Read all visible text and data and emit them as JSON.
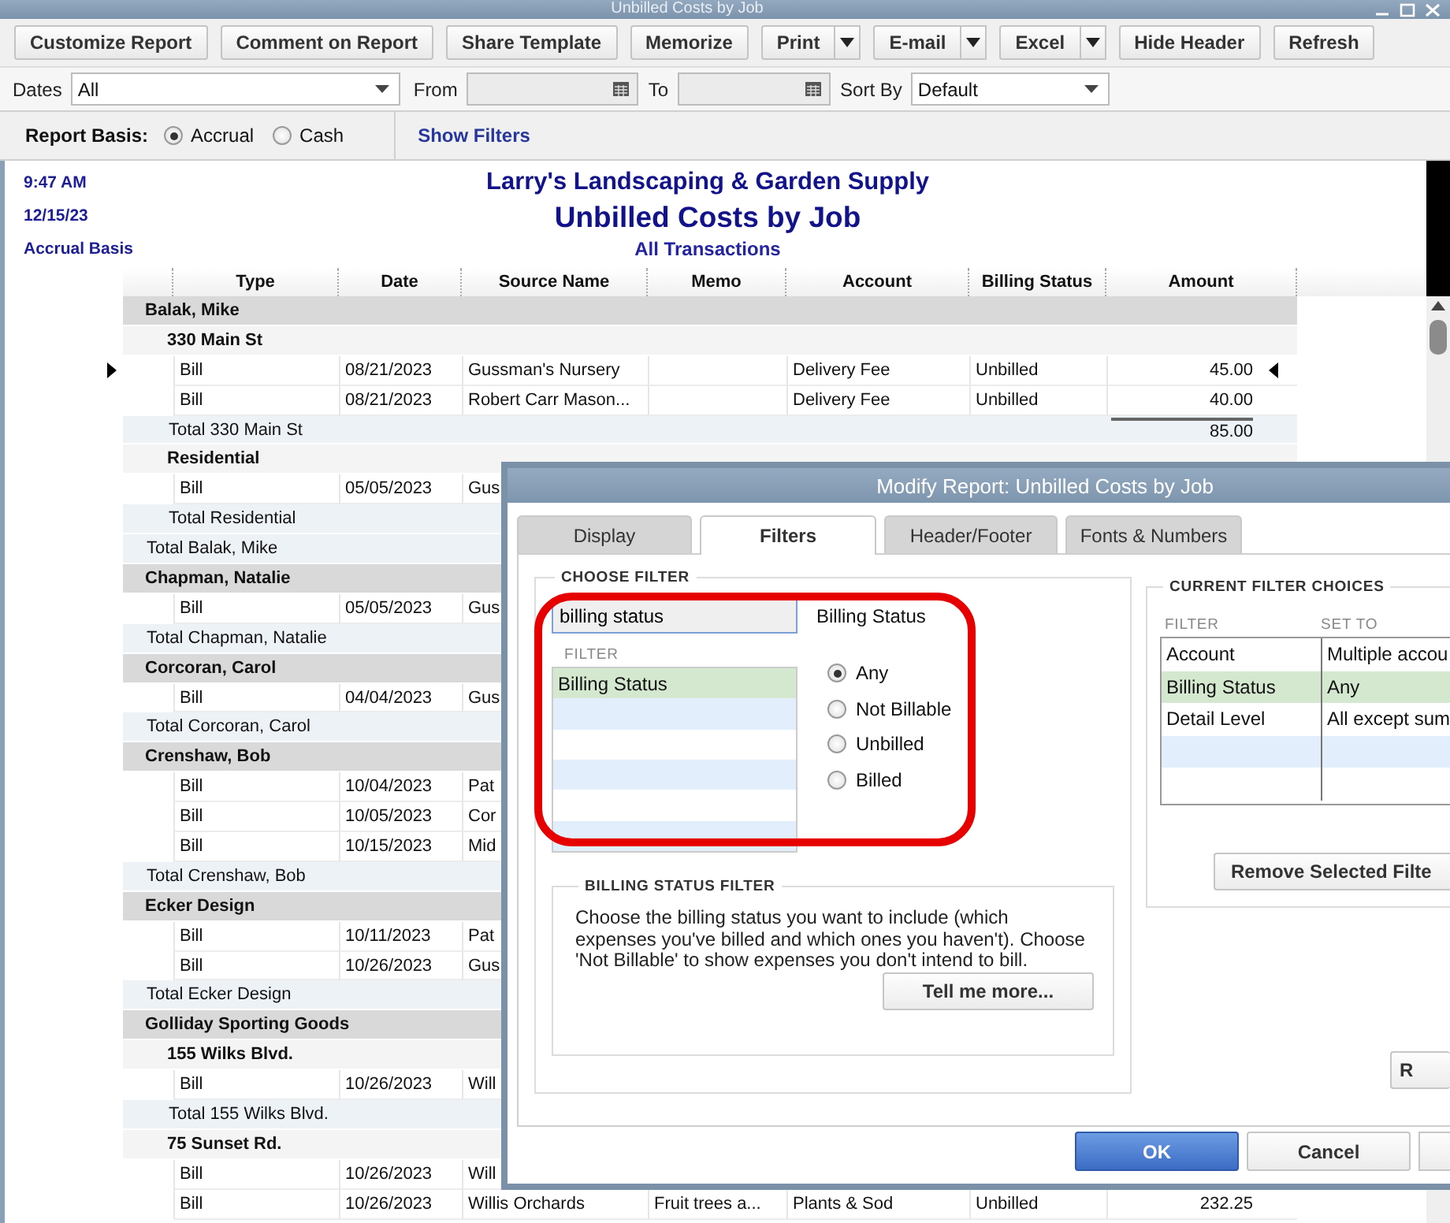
{
  "window": {
    "title": "Unbilled Costs by Job"
  },
  "toolbar": [
    {
      "label": "Customize Report",
      "kind": "button"
    },
    {
      "label": "Comment on Report",
      "kind": "button"
    },
    {
      "label": "Share Template",
      "kind": "button"
    },
    {
      "label": "Memorize",
      "kind": "button"
    },
    {
      "label": "Print",
      "kind": "split"
    },
    {
      "label": "E-mail",
      "kind": "split"
    },
    {
      "label": "Excel",
      "kind": "split"
    },
    {
      "label": "Hide Header",
      "kind": "button"
    },
    {
      "label": "Refresh",
      "kind": "button"
    }
  ],
  "filter_bar": {
    "dates_label": "Dates",
    "dates": "All",
    "from_label": "From",
    "to_label": "To",
    "sort_label": "Sort By",
    "sort": "Default"
  },
  "basis": {
    "label": "Report Basis:",
    "options": [
      {
        "label": "Accrual",
        "selected": true
      },
      {
        "label": "Cash",
        "selected": false
      }
    ],
    "link": "Show Filters"
  },
  "report": {
    "time": "9:47 AM",
    "date": "12/15/23",
    "basis": "Accrual Basis",
    "company": "Larry's Landscaping & Garden Supply",
    "title": "Unbilled Costs by Job",
    "subtitle": "All Transactions",
    "columns": [
      "Type",
      "Date",
      "Source Name",
      "Memo",
      "Account",
      "Billing Status",
      "Amount"
    ],
    "rows": [
      {
        "kind": "customer",
        "label": "Balak, Mike"
      },
      {
        "kind": "job",
        "label": "330 Main St"
      },
      {
        "kind": "bill",
        "current": true,
        "type": "Bill",
        "date": "08/21/2023",
        "source": "Gussman's Nursery",
        "account": "Delivery Fee",
        "status": "Unbilled",
        "amount": "45.00"
      },
      {
        "kind": "bill",
        "current": false,
        "type": "Bill",
        "date": "08/21/2023",
        "source": "Robert Carr Mason...",
        "account": "Delivery Fee",
        "status": "Unbilled",
        "amount": "40.00"
      },
      {
        "kind": "job_total",
        "label": "Total 330 Main St",
        "amount": "85.00"
      },
      {
        "kind": "job",
        "label": "Residential"
      },
      {
        "kind": "bill",
        "current": false,
        "type": "Bill",
        "date": "05/05/2023",
        "source": "Gus"
      },
      {
        "kind": "job_total",
        "label": "Total Residential"
      },
      {
        "kind": "customer_total",
        "label": "Total Balak, Mike"
      },
      {
        "kind": "customer",
        "label": "Chapman, Natalie"
      },
      {
        "kind": "bill",
        "current": false,
        "type": "Bill",
        "date": "05/05/2023",
        "source": "Gus"
      },
      {
        "kind": "customer_total",
        "label": "Total Chapman, Natalie"
      },
      {
        "kind": "customer",
        "label": "Corcoran, Carol"
      },
      {
        "kind": "bill",
        "current": false,
        "type": "Bill",
        "date": "04/04/2023",
        "source": "Gus"
      },
      {
        "kind": "customer_total",
        "label": "Total Corcoran, Carol"
      },
      {
        "kind": "customer",
        "label": "Crenshaw, Bob"
      },
      {
        "kind": "bill",
        "current": false,
        "type": "Bill",
        "date": "10/04/2023",
        "source": "Pat"
      },
      {
        "kind": "bill",
        "current": false,
        "type": "Bill",
        "date": "10/05/2023",
        "source": "Cor"
      },
      {
        "kind": "bill",
        "current": false,
        "type": "Bill",
        "date": "10/15/2023",
        "source": "Mid"
      },
      {
        "kind": "customer_total",
        "label": "Total Crenshaw, Bob"
      },
      {
        "kind": "customer",
        "label": "Ecker Design"
      },
      {
        "kind": "bill",
        "current": false,
        "type": "Bill",
        "date": "10/11/2023",
        "source": "Pat"
      },
      {
        "kind": "bill",
        "current": false,
        "type": "Bill",
        "date": "10/26/2023",
        "source": "Gus"
      },
      {
        "kind": "customer_total",
        "label": "Total Ecker Design"
      },
      {
        "kind": "customer",
        "label": "Golliday Sporting Goods"
      },
      {
        "kind": "job",
        "label": "155 Wilks Blvd."
      },
      {
        "kind": "bill",
        "current": false,
        "type": "Bill",
        "date": "10/26/2023",
        "source": "Will"
      },
      {
        "kind": "job_total",
        "label": "Total 155 Wilks Blvd."
      },
      {
        "kind": "job",
        "label": "75 Sunset Rd."
      },
      {
        "kind": "bill",
        "current": false,
        "type": "Bill",
        "date": "10/26/2023",
        "source": "Will"
      },
      {
        "kind": "bill",
        "current": false,
        "type": "Bill",
        "date": "10/26/2023",
        "source": "Willis Orchards",
        "memo": "Fruit trees a...",
        "account": "Plants & Sod",
        "status": "Unbilled",
        "amount": "232.25"
      }
    ]
  },
  "dialog": {
    "title": "Modify Report: Unbilled Costs by Job",
    "tabs": [
      {
        "label": "Display",
        "selected": false
      },
      {
        "label": "Filters",
        "selected": true
      },
      {
        "label": "Header/Footer",
        "selected": false
      },
      {
        "label": "Fonts & Numbers",
        "selected": false
      }
    ],
    "choose_filter": {
      "title": "CHOOSE FILTER",
      "search": {
        "value": "billing status"
      },
      "list_header": "FILTER",
      "items": [
        {
          "label": "Billing Status",
          "selected": true
        }
      ],
      "detail_title": "Billing Status",
      "options": [
        {
          "label": "Any",
          "selected": true
        },
        {
          "label": "Not Billable",
          "selected": false
        },
        {
          "label": "Unbilled",
          "selected": false
        },
        {
          "label": "Billed",
          "selected": false
        }
      ],
      "help_title": "BILLING STATUS FILTER",
      "help_text": "Choose the billing status you want to include (which expenses you've billed and which ones you haven't). Choose 'Not Billable' to show expenses you don't intend to bill.",
      "help_button": "Tell me more..."
    },
    "current": {
      "title": "CURRENT FILTER CHOICES",
      "columns": [
        "FILTER",
        "SET TO"
      ],
      "rows": [
        {
          "filter": "Account",
          "set_to": "Multiple accou",
          "selected": false
        },
        {
          "filter": "Billing Status",
          "set_to": "Any",
          "selected": true
        },
        {
          "filter": "Detail Level",
          "set_to": "All except sum",
          "selected": false
        }
      ],
      "remove_button": "Remove Selected Filte"
    },
    "side_button": "R",
    "buttons": [
      {
        "label": "OK",
        "kind": "primary"
      },
      {
        "label": "Cancel",
        "kind": "normal"
      }
    ]
  }
}
